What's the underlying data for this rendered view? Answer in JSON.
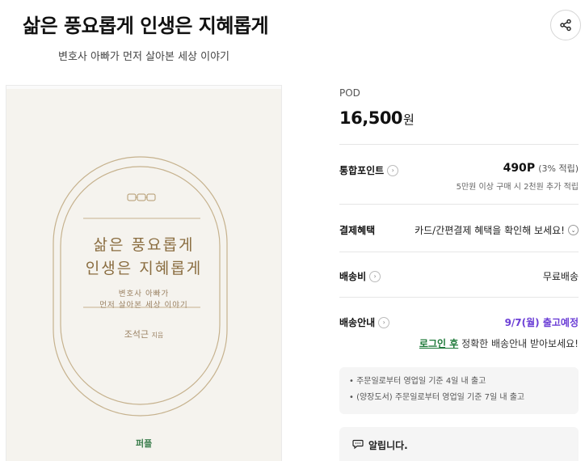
{
  "book": {
    "title": "삶은 풍요롭게 인생은 지혜롭게",
    "subtitle": "변호사 아빠가 먼저 살아본 세상 이야기"
  },
  "cover": {
    "title_line1": "삶은 풍요롭게",
    "title_line2": "인생은 지혜롭게",
    "sub_line1": "변호사 아빠가",
    "sub_line2": "먼저 살아본 세상 이야기",
    "author": "조석근",
    "author_suffix": "지음",
    "publisher_logo": "퍼플",
    "bg_color": "#f5f3ee",
    "gold_color": "#b39a6e"
  },
  "product": {
    "format": "POD",
    "price": "16,500",
    "currency": "원"
  },
  "points": {
    "label": "통합포인트",
    "value": "490",
    "unit": "P",
    "rate": "(3% 적립)",
    "note": "5만원 이상 구매 시 2천원 추가 적립"
  },
  "payment": {
    "label": "결제혜택",
    "text": "카드/간편결제 혜택을 확인해 보세요!"
  },
  "shipping_fee": {
    "label": "배송비",
    "value": "무료배송"
  },
  "shipping_info": {
    "label": "배송안내",
    "date": "9/7(월) 출고예정",
    "login_link": "로그인 후",
    "login_text": " 정확한 배송안내 받아보세요!"
  },
  "notices": [
    "주문일로부터 영업일 기준 4일 내 출고",
    "(양장도서) 주문일로부터 영업일 기준 7일 내 출고"
  ],
  "alert": {
    "title": "알립니다."
  },
  "icons": {
    "share": "share-icon",
    "info": "chevron-right-icon",
    "dropdown": "chevron-down-icon",
    "alert": "speech-bubble-icon"
  }
}
